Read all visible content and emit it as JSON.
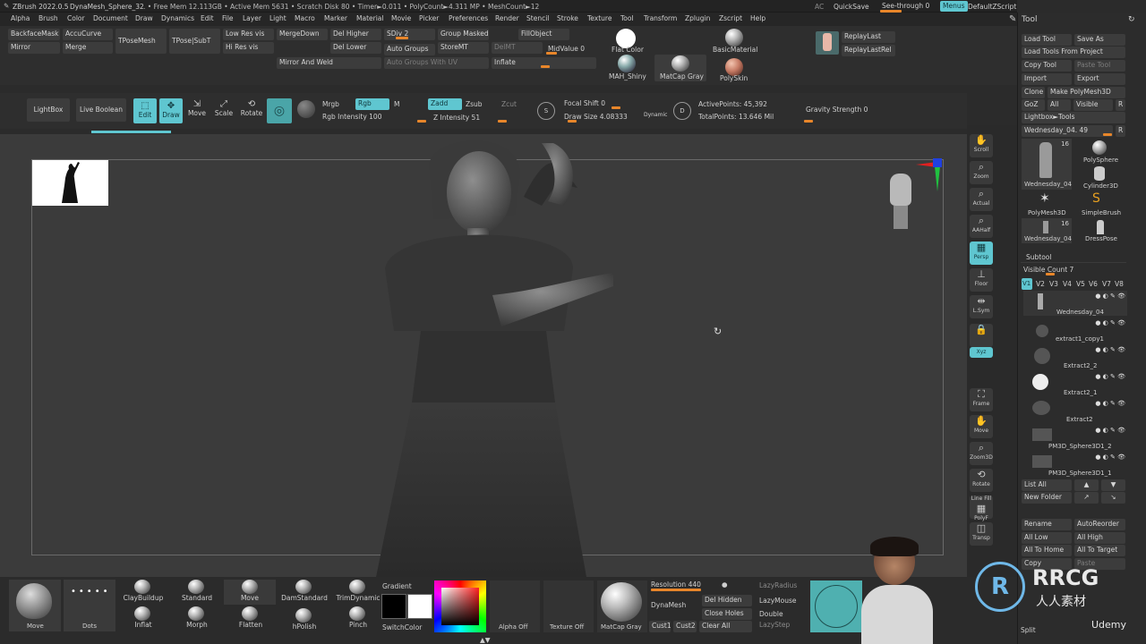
{
  "titlebar": {
    "app": "ZBrush 2022.0.5",
    "doc": "DynaMesh_Sphere_32",
    "stats": ". • Free Mem 12.113GB • Active Mem 5631 • Scratch Disk 80 • Timer►0.011 • PolyCount►4.311 MP • MeshCount►12",
    "ac": "AC",
    "quicksave": "QuickSave",
    "seethrough": "See-through  0",
    "menus": "Menus",
    "script": "DefaultZScript"
  },
  "menus": [
    "Alpha",
    "Brush",
    "Color",
    "Document",
    "Draw",
    "Dynamics",
    "Edit",
    "File",
    "Layer",
    "Light",
    "Macro",
    "Marker",
    "Material",
    "Movie",
    "Picker",
    "Preferences",
    "Render",
    "Stencil",
    "Stroke",
    "Texture",
    "Tool",
    "Transform",
    "Zplugin",
    "Zscript",
    "Help"
  ],
  "palette": {
    "backface": "BackfaceMask",
    "accucurve": "AccuCurve",
    "tposemesh": "TPoseMesh",
    "tposesub": "TPose|SubT",
    "lowres": "Low Res vis",
    "hires": "Hi Res vis",
    "mergedown": "MergeDown",
    "merge": "Merge",
    "mirror": "Mirror",
    "delhigher": "Del Higher",
    "dellower": "Del Lower",
    "sdiv": "SDiv 2",
    "groupmasked": "Group Masked",
    "storemt": "StoreMT",
    "delmt": "DelMT",
    "fillobject": "FillObject",
    "autogroups": "Auto Groups",
    "autogroupsuv": "Auto Groups With UV",
    "midvalue": "MidValue 0",
    "inflate": "Inflate",
    "mirrorweld": "Mirror And Weld",
    "flatcolor": "Flat Color",
    "mahshiny": "MAH_Shiny",
    "matcapgray": "MatCap Gray",
    "basicmaterial": "BasicMaterial",
    "polyskin": "PolySkin",
    "replaylast": "ReplayLast",
    "replaylastrel": "ReplayLastRel"
  },
  "shelf": {
    "lightbox": "LightBox",
    "liveboolean": "Live Boolean",
    "edit": "Edit",
    "draw": "Draw",
    "move": "Move",
    "scale": "Scale",
    "rotate": "Rotate",
    "mrgb": "Mrgb",
    "rgb": "Rgb",
    "m": "M",
    "rgbintensity": "Rgb Intensity 100",
    "zadd": "Zadd",
    "zsub": "Zsub",
    "zcut": "Zcut",
    "zintensity": "Z Intensity 51",
    "focalshift": "Focal Shift 0",
    "drawsize": "Draw Size 4.08333",
    "dynamic": "Dynamic",
    "activepoints": "ActivePoints: 45,392",
    "totalpoints": "TotalPoints: 13.646 Mil",
    "gravity": "Gravity Strength 0"
  },
  "tray": [
    "Scroll",
    "Zoom",
    "Actual",
    "AAHalf",
    "Persp",
    "Floor",
    "L.Sym",
    "Xyz",
    "Frame",
    "Move",
    "Zoom3D",
    "Rotate",
    "Line Fill",
    "PolyF",
    "Transp"
  ],
  "tool": {
    "title": "Tool",
    "load": "Load Tool",
    "saveas": "Save As",
    "loadproject": "Load Tools From Project",
    "copy": "Copy Tool",
    "paste": "Paste Tool",
    "import": "Import",
    "export": "Export",
    "clone": "Clone",
    "makepoly": "Make PolyMesh3D",
    "goz": "GoZ",
    "all": "All",
    "visible": "Visible",
    "r": "R",
    "lightboxtools": "Lightbox►Tools",
    "current": "Wednesday_04. 49",
    "thumbs": [
      {
        "label": "Wednesday_04",
        "badge": "16"
      },
      {
        "label": "PolySphere"
      },
      {
        "label": "Wednesday_04"
      },
      {
        "label": "Cylinder3D"
      },
      {
        "label": "PolyMesh3D"
      },
      {
        "label": "SimpleBrush"
      },
      {
        "label": "Wednesday_04",
        "badge": "16"
      },
      {
        "label": "DressPose"
      }
    ],
    "subtool": "Subtool",
    "visiblecount": "Visible Count 7",
    "vtabs": [
      "V1",
      "V2",
      "V3",
      "V4",
      "V5",
      "V6",
      "V7",
      "V8"
    ],
    "subtools": [
      "Wednesday_04",
      "extract1_copy1",
      "Extract2_2",
      "Extract2_1",
      "Extract2",
      "PM3D_Sphere3D1_2",
      "PM3D_Sphere3D1_1"
    ],
    "listall": "List All",
    "newfolder": "New Folder",
    "rename": "Rename",
    "autoreorder": "AutoReorder",
    "alllow": "All Low",
    "allhigh": "All High",
    "alltohome": "All To Home",
    "alltotarget": "All To Target",
    "copy2": "Copy",
    "paste2": "Paste",
    "split": "Split"
  },
  "bottom": {
    "brushes": [
      "Move",
      "Dots",
      "ClayBuildup",
      "Standard",
      "Move",
      "DamStandard",
      "TrimDynamic",
      "Inflat",
      "Morph",
      "Flatten",
      "hPolish",
      "Pinch"
    ],
    "gradient": "Gradient",
    "switchcolor": "SwitchColor",
    "alphaoff": "Alpha Off",
    "textureoff": "Texture Off",
    "matcapgray": "MatCap Gray",
    "resolution": "Resolution 440",
    "dynamesh": "DynaMesh",
    "delhidden": "Del Hidden",
    "closeholes": "Close Holes",
    "cust1": "Cust1",
    "cust2": "Cust2",
    "clearall": "Clear All",
    "lazyradius": "LazyRadius",
    "lazymouse": "LazyMouse",
    "double": "Double",
    "lazystep": "LazyStep"
  },
  "watermark": {
    "logo": "RRCG",
    "sub": "人人素材",
    "udemy": "Udemy"
  }
}
